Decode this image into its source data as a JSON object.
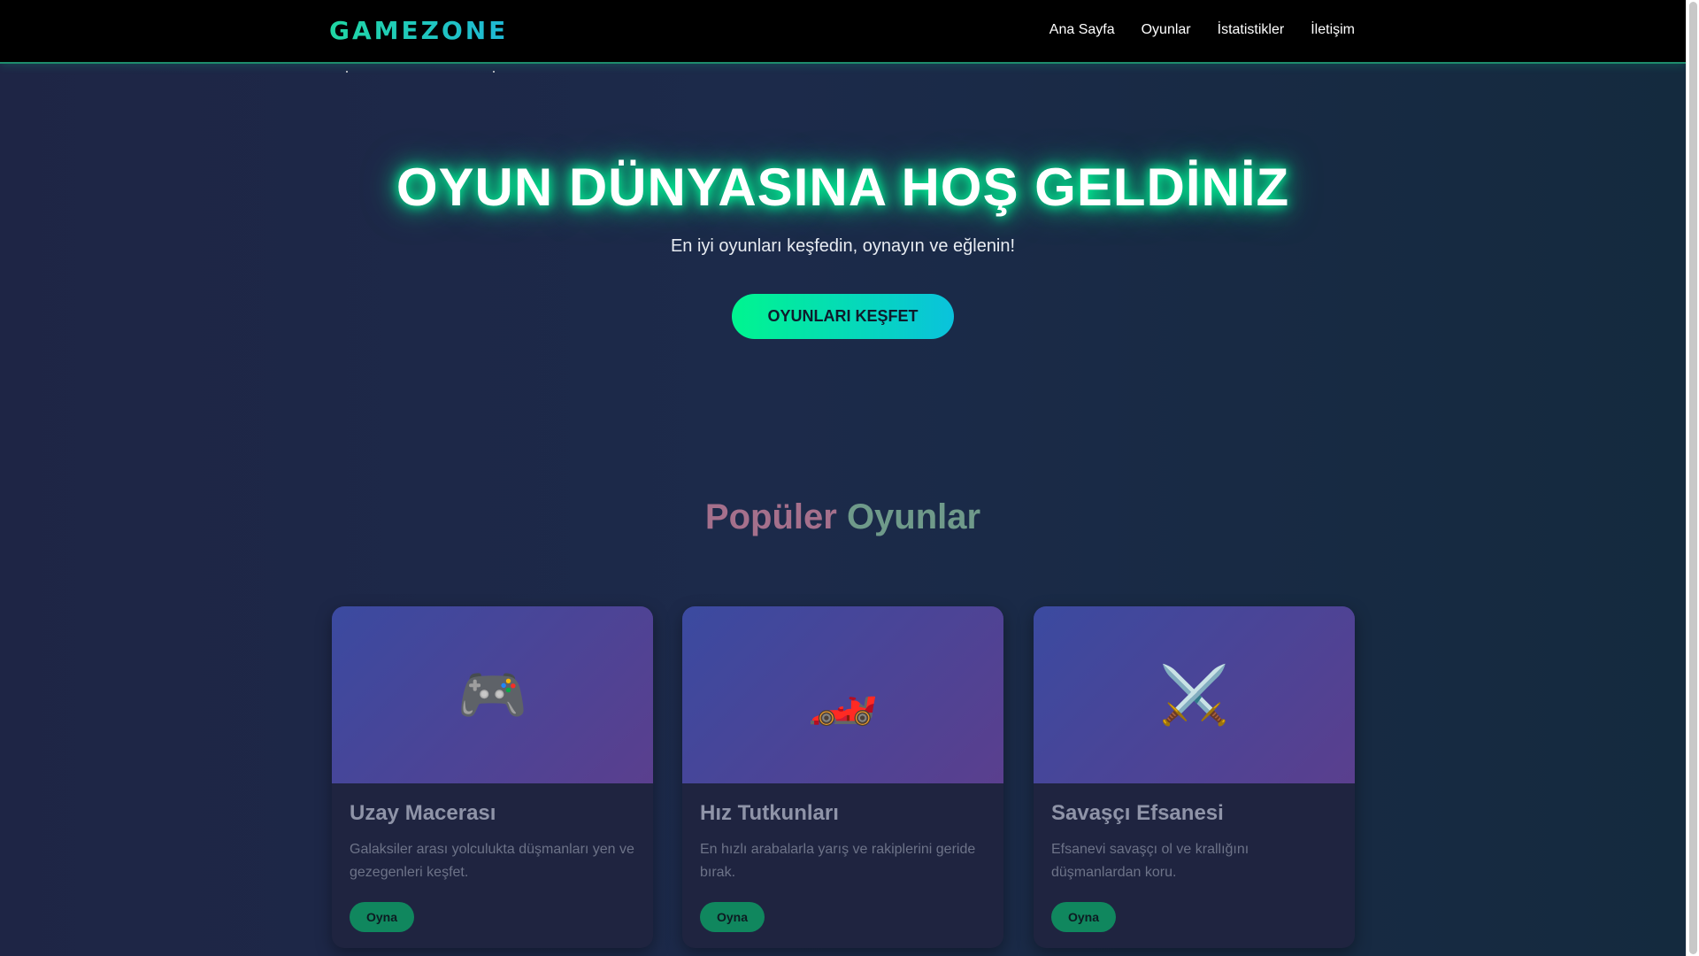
{
  "navbar": {
    "logo": "GAMEZONE",
    "links": [
      "Ana Sayfa",
      "Oyunlar",
      "İstatistikler",
      "İletişim"
    ]
  },
  "hero": {
    "title": "OYUN DÜNYASINA HOŞ GELDİNİZ",
    "subtitle": "En iyi oyunları keşfedin, oynayın ve eğlenin!",
    "cta_label": "OYUNLARI KEŞFET"
  },
  "popular": {
    "title_word1": "Popüler",
    "title_word2": "Oyunlar",
    "cards": [
      {
        "icon": "🎮",
        "icon_name": "gamepad-icon",
        "title": "Uzay Macerası",
        "description": "Galaksiler arası yolculukta düşmanları yen ve gezegenleri keşfet.",
        "button": "Oyna"
      },
      {
        "icon": "🏎️",
        "icon_name": "race-car-icon",
        "title": "Hız Tutkunları",
        "description": "En hızlı arabalarla yarış ve rakiplerini geride bırak.",
        "button": "Oyna"
      },
      {
        "icon": "⚔️",
        "icon_name": "crossed-swords-icon",
        "title": "Savaşçı Efsanesi",
        "description": "Efsanevi savaşçı ol ve krallığını düşmanlardan koru.",
        "button": "Oyna"
      }
    ]
  },
  "colors": {
    "accent_green": "#00f58f",
    "accent_cyan": "#0ac2dc",
    "play_button": "#10875e",
    "background": "#1e2545"
  }
}
